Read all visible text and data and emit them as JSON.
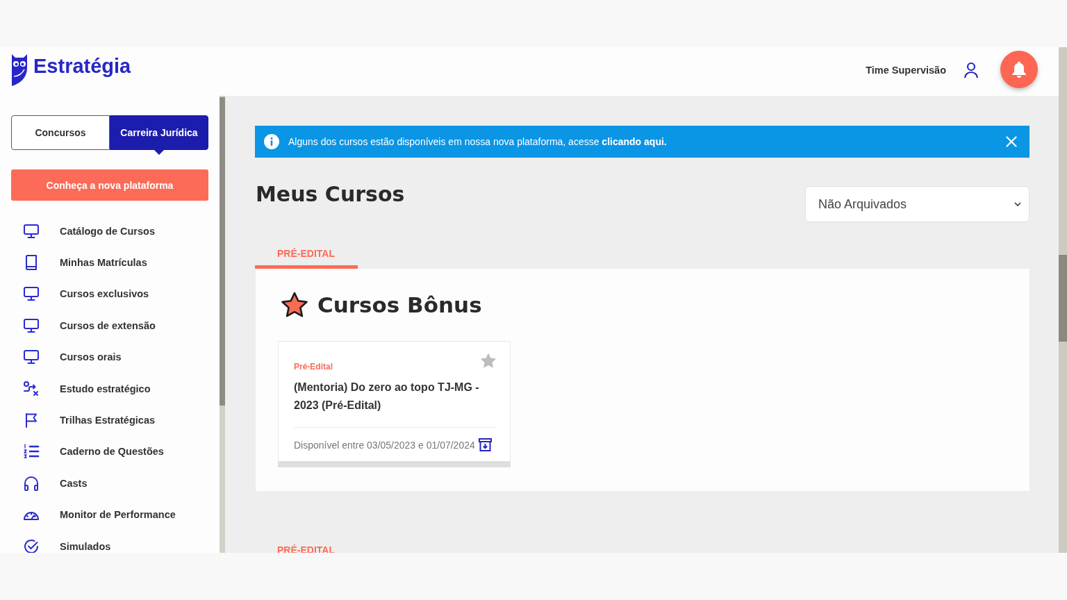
{
  "header": {
    "logo": "Estratégia",
    "user_name": "Time Supervisão"
  },
  "sidebar": {
    "segments": [
      {
        "label": "Concursos",
        "selected": false
      },
      {
        "label": "Carreira Jurídica",
        "selected": true
      }
    ],
    "cta_button": "Conheça a nova plataforma",
    "items": [
      {
        "label": "Catálogo de Cursos",
        "kind": "monitor"
      },
      {
        "label": "Minhas Matrículas",
        "kind": "book"
      },
      {
        "label": "Cursos exclusivos",
        "kind": "monitor"
      },
      {
        "label": "Cursos de extensão",
        "kind": "monitor"
      },
      {
        "label": "Cursos orais",
        "kind": "monitor"
      },
      {
        "label": "Estudo estratégico",
        "kind": "route"
      },
      {
        "label": "Trilhas Estratégicas",
        "kind": "flag"
      },
      {
        "label": "Caderno de Questões",
        "kind": "list"
      },
      {
        "label": "Casts",
        "kind": "headphones"
      },
      {
        "label": "Monitor de Performance",
        "kind": "gauge"
      },
      {
        "label": "Simulados",
        "kind": "check"
      }
    ]
  },
  "banner": {
    "text": "Alguns dos cursos estão disponíveis em nossa nova plataforma, acesse",
    "link": "clicando aqui."
  },
  "main": {
    "title": "Meus Cursos",
    "filter": {
      "value": "Não Arquivados"
    },
    "sections": [
      {
        "tabs": [
          {
            "label": "PRÉ-EDITAL",
            "selected": true
          }
        ],
        "title": "Cursos Bônus",
        "cards": [
          {
            "category": "Pré-Edital",
            "title": "(Mentoria) Do zero ao topo TJ-MG - 2023 (Pré-Edital)",
            "availability": "Disponível entre 03/05/2023 e 01/07/2024",
            "favorited": false
          }
        ]
      },
      {
        "tabs": [
          {
            "label": "PRÉ-EDITAL",
            "selected": true
          }
        ]
      }
    ]
  }
}
